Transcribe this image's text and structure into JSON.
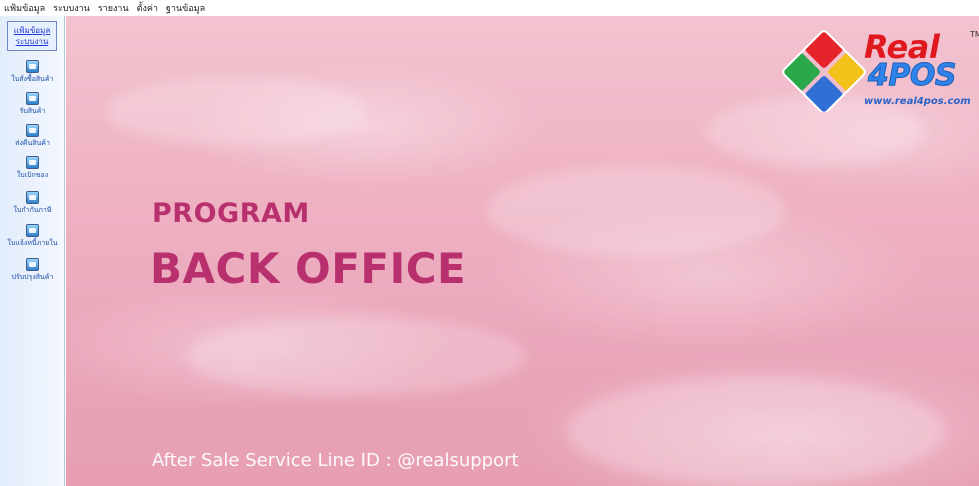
{
  "menubar": {
    "items": [
      "แฟ้มข้อมูล",
      "ระบบงาน",
      "รายงาน",
      "ตั้งค่า",
      "ฐานข้อมูล"
    ]
  },
  "sidebar": {
    "tabs": [
      {
        "label": "แฟ้มข้อมูล"
      },
      {
        "label": "ระบบงาน"
      }
    ],
    "items": [
      {
        "label": "ใบสั่งซื้อสินค้า",
        "icon": "document-icon"
      },
      {
        "label": "รับสินค้า",
        "icon": "receive-icon"
      },
      {
        "label": "ส่งคืนสินค้า",
        "icon": "return-icon"
      },
      {
        "label": "ใบเบิกของ",
        "icon": "requisition-icon"
      },
      {
        "label": "ใบกำกับภาษี",
        "icon": "tax-invoice-icon"
      },
      {
        "label": "ใบแจ้งหนี้ภายใน",
        "icon": "invoice-icon"
      },
      {
        "label": "ปรับปรุงสินค้า",
        "icon": "adjust-stock-icon"
      }
    ]
  },
  "banner": {
    "title_small": "PROGRAM",
    "title_large": "BACK OFFICE",
    "footer": "After Sale Service Line ID : @realsupport"
  },
  "logo": {
    "word1": "Real",
    "word2": "4POS",
    "tm": "TM",
    "url": "www.real4pos.com"
  },
  "colors": {
    "title": "#b8316e",
    "logo_red": "#e0191f",
    "logo_blue": "#2f83ea"
  }
}
